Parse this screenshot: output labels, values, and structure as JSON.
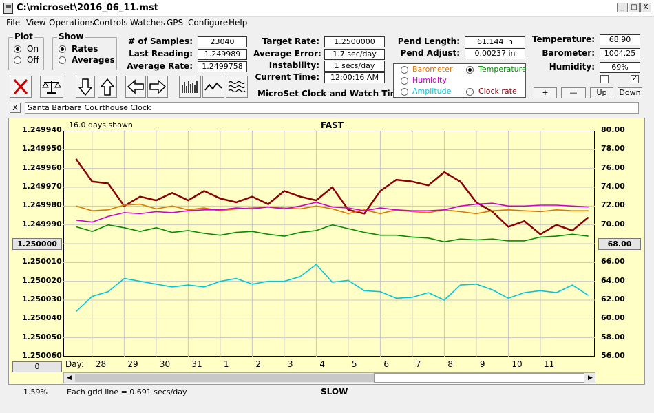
{
  "window": {
    "title": "C:\\microset\\2016_06_11.mst",
    "min": "_",
    "max": "□",
    "close": "X"
  },
  "menu": [
    "File",
    "View",
    "Operations",
    "Controls",
    "Watches",
    "GPS",
    "Configure",
    "Help"
  ],
  "plot_group": {
    "title": "Plot",
    "on": "On",
    "off": "Off",
    "selected": "On"
  },
  "show_group": {
    "title": "Show",
    "rates": "Rates",
    "averages": "Averages",
    "selected": "Rates"
  },
  "stats": {
    "samples_label": "# of Samples:",
    "samples": "23040",
    "last_reading_label": "Last Reading:",
    "last_reading": "1.249989",
    "average_rate_label": "Average Rate:",
    "average_rate": "1.2499758",
    "target_rate_label": "Target Rate:",
    "target_rate": "1.2500000",
    "average_error_label": "Average Error:",
    "average_error": "1.7 sec/day",
    "instability_label": "Instability:",
    "instability": "1 secs/day",
    "current_time_label": "Current Time:",
    "current_time": "12:00:16 AM",
    "pend_length_label": "Pend Length:",
    "pend_length": "61.144 in",
    "pend_adjust_label": "Pend Adjust:",
    "pend_adjust": "0.00237 in",
    "temperature_label": "Temperature:",
    "temperature": "68.90",
    "barometer_label": "Barometer:",
    "barometer": "1004.25",
    "humidity_label": "Humidity:",
    "humidity": "69%"
  },
  "app_name": "MicroSet Clock and Watch Timer",
  "sensor_options": [
    {
      "label": "Barometer",
      "color": "#e07800",
      "selected": false
    },
    {
      "label": "Temperature",
      "color": "#009000",
      "selected": true
    },
    {
      "label": "Humidity",
      "color": "#d000d0",
      "selected": false
    },
    {
      "label": "Clock rate",
      "color": "#8b0000",
      "selected": false
    },
    {
      "label": "Amplitude",
      "color": "#00c8d8",
      "selected": false
    }
  ],
  "adjust_buttons": {
    "plus": "+",
    "minus": "—",
    "up": "Up",
    "down": "Down"
  },
  "checkboxes": {
    "first": false,
    "second": true
  },
  "clock_name": "Santa Barbara Courthouse Clock",
  "close_small": "X",
  "chart_header": {
    "days_shown": "16.0 days shown",
    "fast": "FAST",
    "slow": "SLOW"
  },
  "left_center_button": "1.250000",
  "right_center_button": "68.00",
  "bottom_left_button": "0",
  "day_label": "Day:",
  "status": {
    "percent": "1.59%",
    "grid_note": "Each grid line = 0.691 secs/day"
  },
  "chart_data": {
    "type": "line",
    "left_axis_ticks": [
      "1.249940",
      "1.249950",
      "1.249960",
      "1.249970",
      "1.249980",
      "1.249990",
      "1.250000",
      "1.250010",
      "1.250020",
      "1.250030",
      "1.250040",
      "1.250050",
      "1.250060"
    ],
    "right_axis_ticks": [
      "80.00",
      "78.00",
      "76.00",
      "74.00",
      "72.00",
      "70.00",
      "68.00",
      "66.00",
      "64.00",
      "62.00",
      "60.00",
      "58.00",
      "56.00"
    ],
    "x_ticks": [
      "28",
      "29",
      "30",
      "31",
      "1",
      "2",
      "3",
      "4",
      "5",
      "6",
      "7",
      "8",
      "9",
      "10",
      "11"
    ],
    "x": [
      27,
      27.5,
      28,
      28.5,
      29,
      29.5,
      30,
      30.5,
      31,
      31.5,
      32,
      32.5,
      33,
      33.5,
      34,
      34.5,
      35,
      35.5,
      36,
      36.5,
      37,
      37.5,
      38,
      38.5,
      39,
      39.5,
      40,
      40.5,
      41,
      41.5,
      42,
      42.5,
      43
    ],
    "ylim": [
      1.24994,
      1.25006
    ],
    "y2lim": [
      56,
      80
    ],
    "series": [
      {
        "name": "Clock rate",
        "color": "#8b0000",
        "axis": "left",
        "values": [
          1.249955,
          1.249967,
          1.249968,
          1.24998,
          1.249975,
          1.249977,
          1.249973,
          1.249977,
          1.249972,
          1.249976,
          1.249978,
          1.249975,
          1.249979,
          1.249972,
          1.249975,
          1.249977,
          1.24997,
          1.249982,
          1.249984,
          1.249972,
          1.249966,
          1.249967,
          1.249969,
          1.249962,
          1.249967,
          1.249978,
          1.249983,
          1.249991,
          1.249988,
          1.249995,
          1.24999,
          1.249993,
          1.249986
        ]
      },
      {
        "name": "Barometer",
        "color": "#e07800",
        "axis": "right",
        "values": [
          72.0,
          71.5,
          71.6,
          72.1,
          72.2,
          71.7,
          72.0,
          71.6,
          71.8,
          71.5,
          71.7,
          71.8,
          71.9,
          71.8,
          71.7,
          72.0,
          71.7,
          71.2,
          71.6,
          71.2,
          71.6,
          71.4,
          71.3,
          71.6,
          71.4,
          71.2,
          71.5,
          71.6,
          71.5,
          71.4,
          71.6,
          71.5,
          71.5
        ]
      },
      {
        "name": "Humidity",
        "color": "#d000d0",
        "axis": "right",
        "values": [
          70.5,
          70.3,
          70.9,
          71.3,
          71.2,
          71.4,
          71.3,
          71.5,
          71.6,
          71.6,
          71.8,
          71.7,
          71.9,
          71.7,
          72.0,
          72.4,
          71.9,
          71.8,
          71.5,
          71.8,
          71.6,
          71.5,
          71.5,
          71.6,
          72.0,
          72.2,
          72.3,
          72.0,
          72.0,
          72.1,
          72.1,
          72.0,
          71.9
        ]
      },
      {
        "name": "Temperature",
        "color": "#009000",
        "axis": "right",
        "values": [
          69.8,
          69.3,
          70.0,
          69.7,
          69.3,
          69.7,
          69.2,
          69.4,
          69.1,
          68.9,
          69.2,
          69.3,
          69.0,
          68.8,
          69.2,
          69.4,
          70.0,
          69.6,
          69.2,
          68.9,
          68.9,
          68.7,
          68.6,
          68.2,
          68.5,
          68.4,
          68.5,
          68.3,
          68.3,
          68.7,
          68.8,
          69.0,
          68.8
        ]
      },
      {
        "name": "Amplitude",
        "color": "#00c8d8",
        "axis": "right",
        "values": [
          60.8,
          62.4,
          62.9,
          64.3,
          64.0,
          63.7,
          63.4,
          63.6,
          63.4,
          64.0,
          64.3,
          63.7,
          64.0,
          64.0,
          64.5,
          65.8,
          63.9,
          64.1,
          63.0,
          62.9,
          62.2,
          62.3,
          62.8,
          62.0,
          63.6,
          63.7,
          63.1,
          62.2,
          62.8,
          63.0,
          62.8,
          63.6,
          62.5
        ]
      }
    ]
  }
}
